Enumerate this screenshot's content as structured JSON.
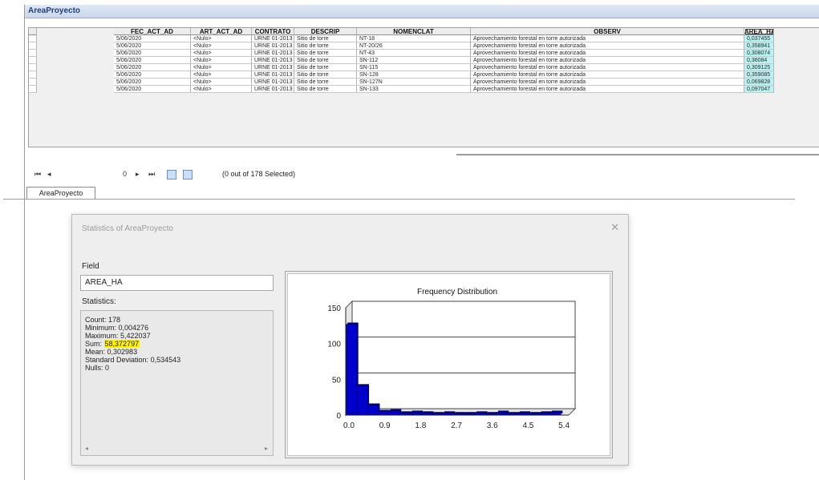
{
  "window": {
    "title": "AreaProyecto"
  },
  "table": {
    "columns": [
      "FEC_ACT_AD",
      "ART_ACT_AD",
      "CONTRATO",
      "DESCRIP",
      "NOMENCLAT",
      "OBSERV",
      "AREA_HA"
    ],
    "selected_column": "AREA_HA",
    "rows": [
      [
        "5/06/2020",
        "<Nulo>",
        "URNE 01-2013",
        "Sitio de torre",
        "NT-18",
        "Aprovechamiento forestal en torre autorizada",
        "0,037455"
      ],
      [
        "5/06/2020",
        "<Nulo>",
        "URNE 01-2013",
        "Sitio de torre",
        "NT-20/26",
        "Aprovechamiento forestal en torre autorizada",
        "0,358941"
      ],
      [
        "5/06/2020",
        "<Nulo>",
        "URNE 01-2013",
        "Sitio de torre",
        "NT-43",
        "Aprovechamiento forestal en torre autorizada",
        "0,308074"
      ],
      [
        "5/06/2020",
        "<Nulo>",
        "URNE 01-2013",
        "Sitio de torre",
        "SN-112",
        "Aprovechamiento forestal en torre autorizada",
        "0,36084"
      ],
      [
        "5/06/2020",
        "<Nulo>",
        "URNE 01-2013",
        "Sitio de torre",
        "SN-115",
        "Aprovechamiento forestal en torre autorizada",
        "0,309125"
      ],
      [
        "5/06/2020",
        "<Nulo>",
        "URNE 01-2013",
        "Sitio de torre",
        "SN-128",
        "Aprovechamiento forestal en torre autorizada",
        "0,359085"
      ],
      [
        "5/06/2020",
        "<Nulo>",
        "URNE 01-2013",
        "Sitio de torre",
        "SN-127N",
        "Aprovechamiento forestal en torre autorizada",
        "0,069828"
      ],
      [
        "5/06/2020",
        "<Nulo>",
        "URNE 01-2013",
        "Sitio de torre",
        "SN-133",
        "Aprovechamiento forestal en torre autorizada",
        "0,097047"
      ]
    ]
  },
  "navigation": {
    "first": "⏮",
    "prev": "◂",
    "record": "0",
    "next": "▸",
    "last": "⏭",
    "status": "(0 out of 178 Selected)"
  },
  "tab": {
    "label": "AreaProyecto"
  },
  "statistics_dialog": {
    "title": "Statistics of AreaProyecto",
    "close": "✕",
    "field_label": "Field",
    "field_value": "AREA_HA",
    "statistics_label": "Statistics:",
    "stats": [
      {
        "label": "Count:",
        "value": "178"
      },
      {
        "label": "Minimum:",
        "value": "0,004276"
      },
      {
        "label": "Maximum:",
        "value": "5,422037"
      },
      {
        "label": "Sum:",
        "value": "58,372797",
        "highlight": true
      },
      {
        "label": "Mean:",
        "value": "0,302983"
      },
      {
        "label": "Standard Deviation:",
        "value": "0,534543"
      },
      {
        "label": "Nulls:",
        "value": "0"
      }
    ]
  },
  "chart_data": {
    "type": "bar",
    "title": "Frequency Distribution",
    "x_ticks": [
      "0.0",
      "0.9",
      "1.8",
      "2.7",
      "3.6",
      "4.5",
      "5.4"
    ],
    "y_ticks": [
      "0",
      "50",
      "100",
      "150"
    ],
    "ylim": [
      0,
      150
    ],
    "xlim": [
      0,
      5.6
    ],
    "bins": [
      {
        "x": 0.14,
        "value": 127
      },
      {
        "x": 0.41,
        "value": 41
      },
      {
        "x": 0.68,
        "value": 14
      },
      {
        "x": 0.95,
        "value": 5
      },
      {
        "x": 1.22,
        "value": 6
      },
      {
        "x": 1.49,
        "value": 3
      },
      {
        "x": 1.76,
        "value": 4
      },
      {
        "x": 2.03,
        "value": 3
      },
      {
        "x": 2.3,
        "value": 2
      },
      {
        "x": 2.57,
        "value": 3
      },
      {
        "x": 2.84,
        "value": 2
      },
      {
        "x": 3.11,
        "value": 2
      },
      {
        "x": 3.38,
        "value": 3
      },
      {
        "x": 3.65,
        "value": 2
      },
      {
        "x": 3.92,
        "value": 4
      },
      {
        "x": 4.19,
        "value": 2
      },
      {
        "x": 4.46,
        "value": 3
      },
      {
        "x": 4.73,
        "value": 2
      },
      {
        "x": 5.0,
        "value": 3
      },
      {
        "x": 5.27,
        "value": 4
      }
    ],
    "bar_color": "#0000cc",
    "grid": true
  }
}
